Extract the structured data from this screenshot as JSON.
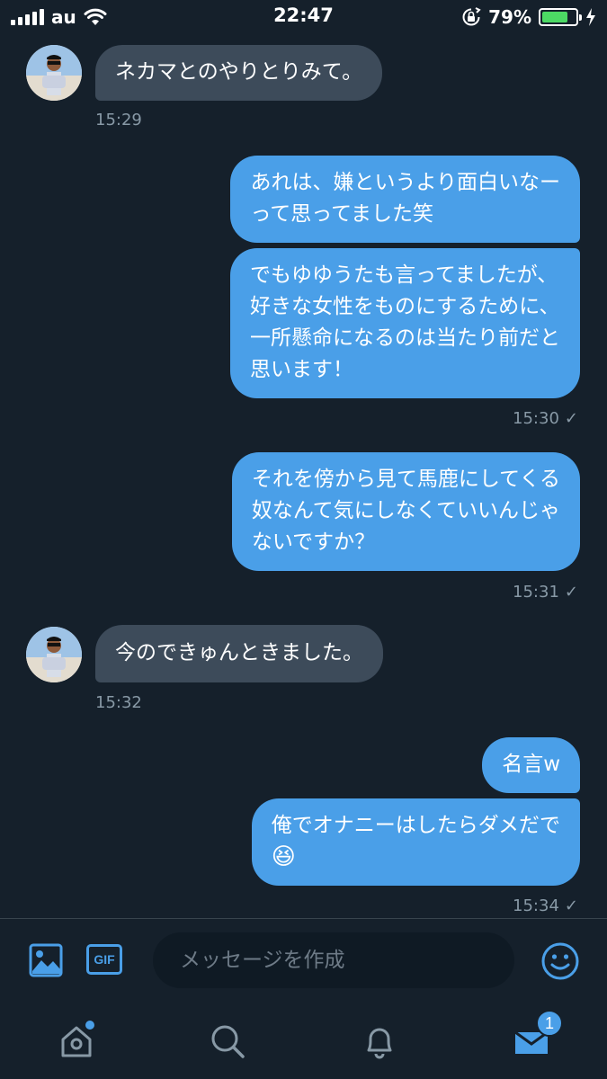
{
  "status_bar": {
    "carrier": "au",
    "time": "22:47",
    "battery_percent": "79%",
    "battery_level": 0.79
  },
  "messages": [
    {
      "text": "ネカマとのやりとりみて。",
      "time": "15:29"
    },
    {
      "text": "あれは、嫌というより面白いなー\nって思ってました笑"
    },
    {
      "text": "でもゆゆうたも言ってましたが、\n好きな女性をものにするために、\n一所懸命になるのは当たり前だと\n思います！",
      "time": "15:30"
    },
    {
      "text": "それを傍から見て馬鹿にしてくる\n奴なんて気にしなくていいんじゃ\nないですか？",
      "time": "15:31"
    },
    {
      "text": "今のできゅんときました。",
      "time": "15:32"
    },
    {
      "text": "名言w"
    },
    {
      "text": "俺でオナニーはしたらダメだで",
      "emoji": "😆",
      "time": "15:34"
    }
  ],
  "read_check": "✓",
  "composer": {
    "placeholder": "メッセージを作成",
    "gif_label": "GIF"
  },
  "tabbar": {
    "messages_badge": "1"
  },
  "colors": {
    "background": "#15202b",
    "accent": "#4a9fe8",
    "incoming_bubble": "#3d4b5a",
    "muted_text": "#8899a6"
  }
}
